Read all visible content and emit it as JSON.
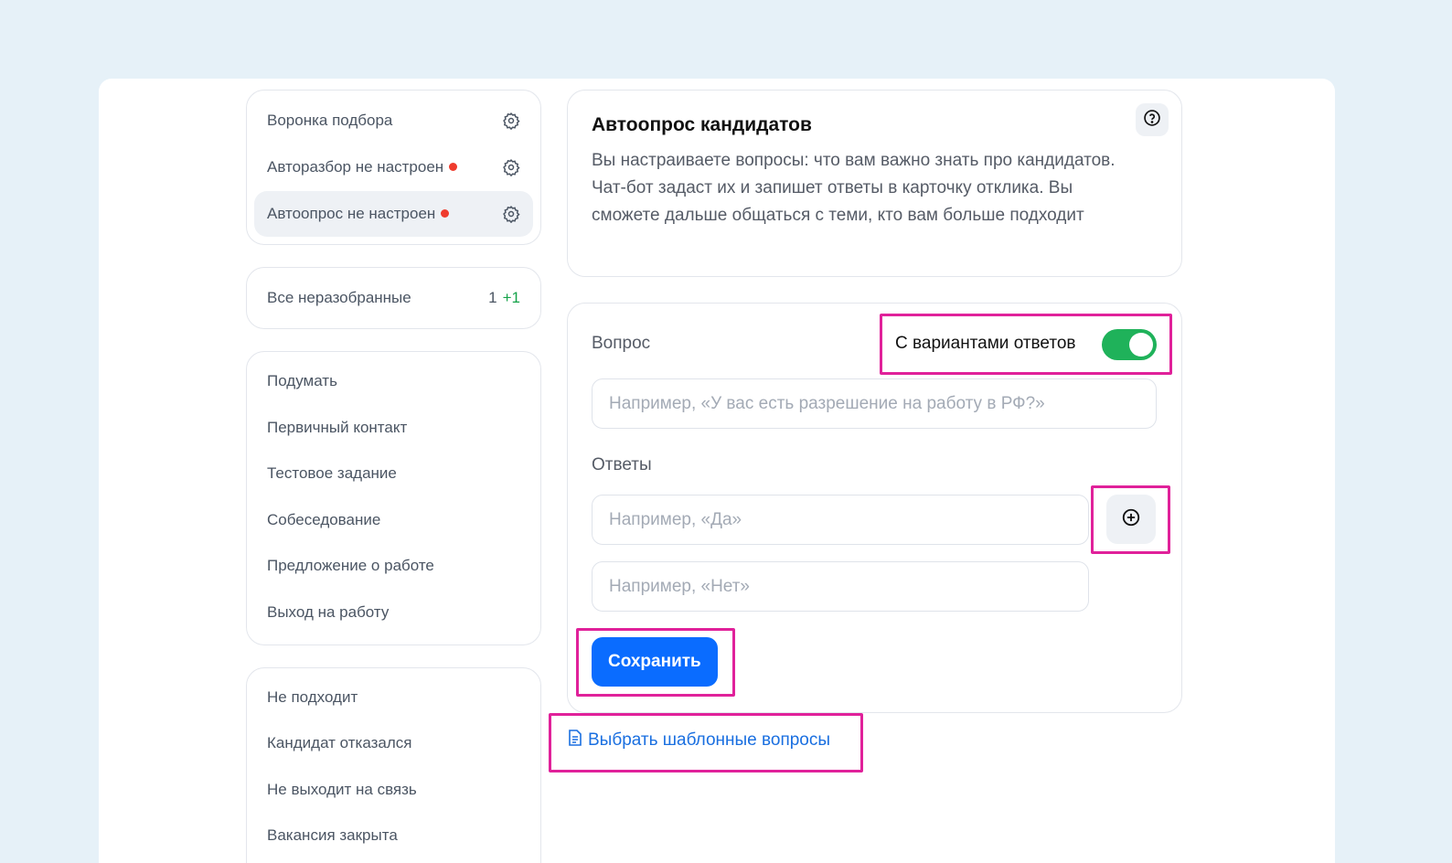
{
  "sidebar": {
    "settings": [
      {
        "label": "Воронка подбора",
        "alert": false
      },
      {
        "label": "Авторазбор не настроен",
        "alert": true
      },
      {
        "label": "Автоопрос не настроен",
        "alert": true
      }
    ],
    "unsorted": {
      "label": "Все неразобранные",
      "count": "1",
      "delta": "+1"
    },
    "stages": [
      "Подумать",
      "Первичный контакт",
      "Тестовое задание",
      "Собеседование",
      "Предложение о работе",
      "Выход на работу"
    ],
    "rejected": [
      "Не подходит",
      "Кандидат отказался",
      "Не выходит на связь",
      "Вакансия закрыта"
    ]
  },
  "intro": {
    "title": "Автоопрос кандидатов",
    "description": "Вы настраиваете вопросы: что вам важно знать про кандидатов. Чат-бот задаст их и запишет ответы в карточку отклика. Вы сможете дальше общаться с теми, кто вам больше подходит",
    "help_icon": "question-circle-icon"
  },
  "form": {
    "question_label": "Вопрос",
    "toggle_label": "С вариантами ответов",
    "toggle_on": true,
    "question_placeholder": "Например, «У вас есть разрешение на работу в РФ?»",
    "answers_label": "Ответы",
    "answer_placeholders": [
      "Например, «Да»",
      "Например, «Нет»"
    ],
    "add_icon": "plus-circle-icon",
    "save_label": "Сохранить"
  },
  "template_link": {
    "label": "Выбрать шаблонные вопросы",
    "icon": "document-icon"
  },
  "colors": {
    "accent": "#0a6cff",
    "toggle": "#1fb25a",
    "alert": "#ef3b2d",
    "highlight": "#e0219a",
    "link": "#1a6fe0"
  }
}
